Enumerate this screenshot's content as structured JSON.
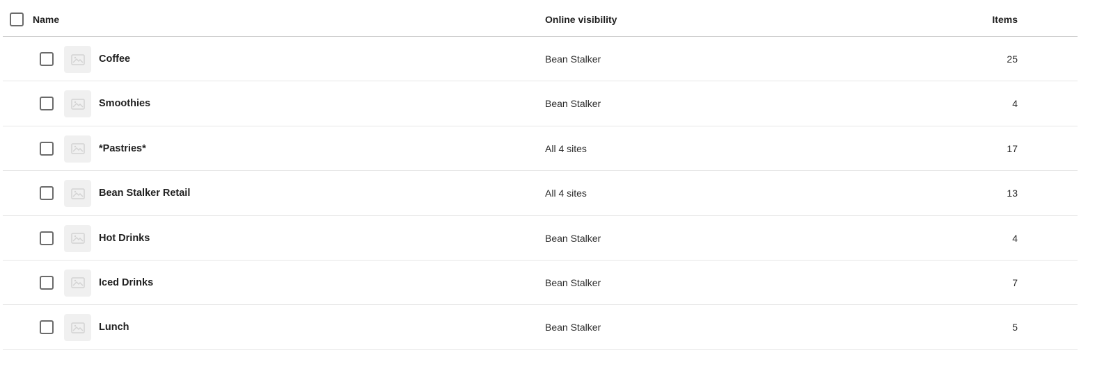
{
  "table": {
    "headers": {
      "name": "Name",
      "visibility": "Online visibility",
      "items": "Items"
    },
    "rows": [
      {
        "name": "Coffee",
        "visibility": "Bean Stalker",
        "items": "25"
      },
      {
        "name": "Smoothies",
        "visibility": "Bean Stalker",
        "items": "4"
      },
      {
        "name": "*Pastries*",
        "visibility": "All 4 sites",
        "items": "17"
      },
      {
        "name": "Bean Stalker Retail",
        "visibility": "All 4 sites",
        "items": "13"
      },
      {
        "name": "Hot Drinks",
        "visibility": "Bean Stalker",
        "items": "4"
      },
      {
        "name": "Iced Drinks",
        "visibility": "Bean Stalker",
        "items": "7"
      },
      {
        "name": "Lunch",
        "visibility": "Bean Stalker",
        "items": "5"
      }
    ]
  },
  "icons": {
    "row_thumbnail": "image-placeholder-icon",
    "select_all": "checkbox-icon"
  },
  "colors": {
    "checkbox_border": "#6b6b6b",
    "thumbnail_bg": "#f0f0f0",
    "header_divider": "#cfcfcf",
    "row_divider": "#e6e6e6"
  }
}
